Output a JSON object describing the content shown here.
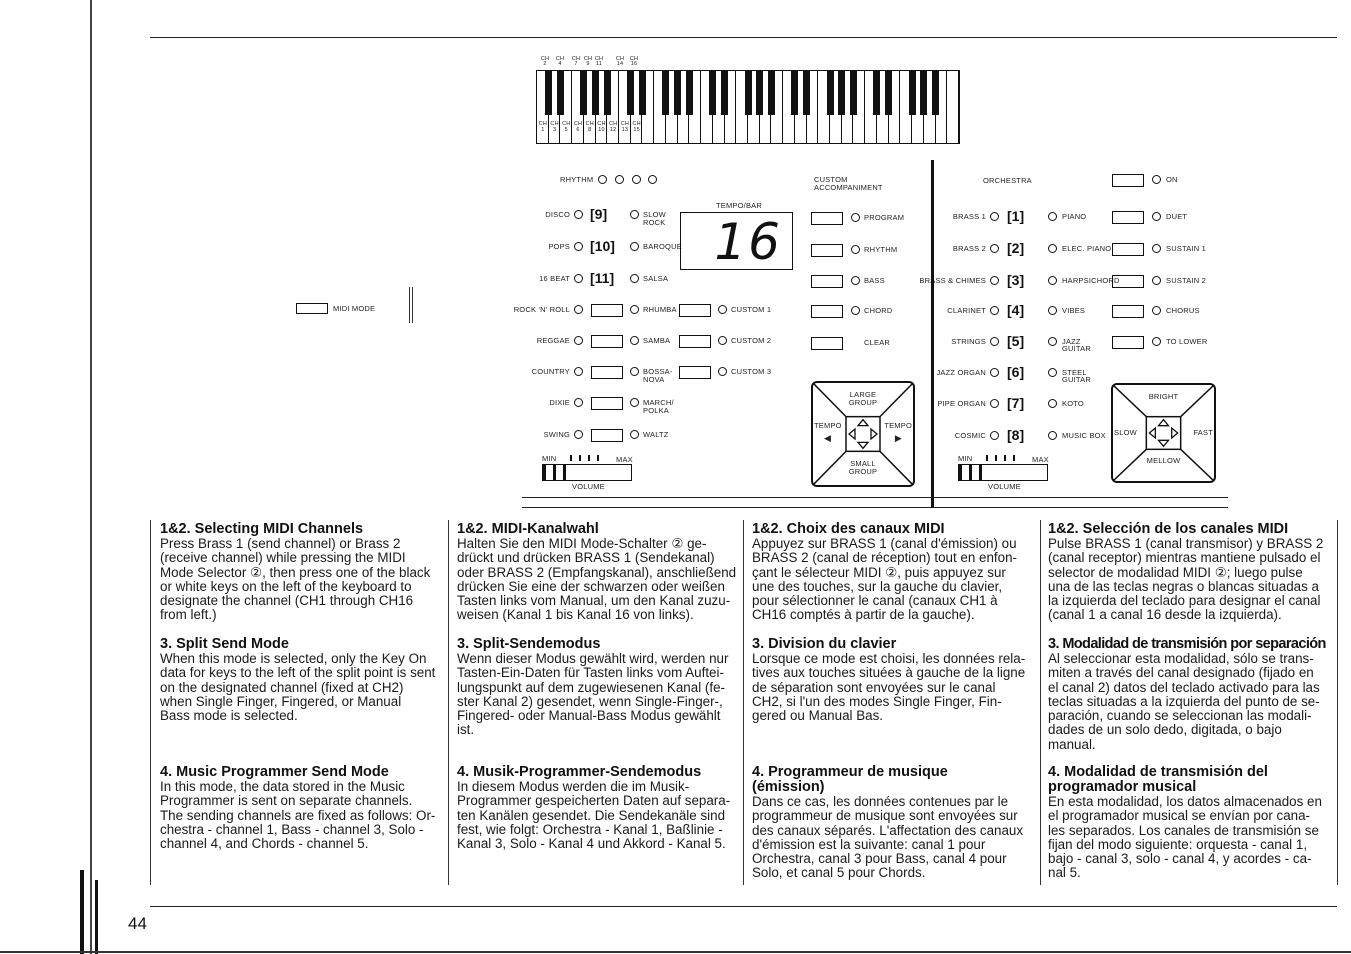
{
  "page_number": "44",
  "midi_mode_label": "MIDI MODE",
  "keyboard": {
    "black_key_channels": [
      "CH 2",
      "CH 4",
      "CH 7",
      "CH 9",
      "CH 11",
      "CH 14",
      "CH 16"
    ],
    "white_key_channels": [
      "CH 1",
      "CH 3",
      "CH 5",
      "CH 6",
      "CH 8",
      "CH 10",
      "CH 12",
      "CH 13",
      "CH 15"
    ]
  },
  "panel": {
    "rhythm_label": "RHYTHM",
    "tempo_bar_label": "TEMPO/BAR",
    "display_value": "16",
    "rhythm_rows": [
      {
        "left": "DISCO",
        "num": "[9]",
        "right": "SLOW ROCK"
      },
      {
        "left": "POPS",
        "num": "[10]",
        "right": "BAROQUE"
      },
      {
        "left": "16 BEAT",
        "num": "[11]",
        "right": "SALSA"
      },
      {
        "left": "ROCK 'N' ROLL",
        "num": "",
        "right": "RHUMBA",
        "custom": "CUSTOM 1"
      },
      {
        "left": "REGGAE",
        "num": "",
        "right": "SAMBA",
        "custom": "CUSTOM 2"
      },
      {
        "left": "COUNTRY",
        "num": "",
        "right": "BOSSA-NOVA",
        "custom": "CUSTOM 3"
      },
      {
        "left": "DIXIE",
        "num": "",
        "right": "MARCH/ POLKA"
      },
      {
        "left": "SWING",
        "num": "",
        "right": "WALTZ"
      }
    ],
    "custom_accompaniment_label": "CUSTOM ACCOMPANIMENT",
    "custom_accompaniment": [
      "PROGRAM",
      "RHYTHM",
      "BASS",
      "CHORD",
      "CLEAR"
    ],
    "left_pad": {
      "top": "LARGE GROUP",
      "bottom": "SMALL GROUP",
      "left": "TEMPO",
      "right": "TEMPO"
    },
    "volume": {
      "min": "MIN",
      "max": "MAX",
      "label": "VOLUME",
      "level_fraction": 0.25
    },
    "orchestra_label": "ORCHESTRA",
    "orchestra_rows": [
      {
        "left": "BRASS 1",
        "num": "[1]",
        "right": "PIANO"
      },
      {
        "left": "BRASS 2",
        "num": "[2]",
        "right": "ELEC. PIANO"
      },
      {
        "left": "BRASS & CHIMES",
        "num": "[3]",
        "right": "HARPSICHORD"
      },
      {
        "left": "CLARINET",
        "num": "[4]",
        "right": "VIBES"
      },
      {
        "left": "STRINGS",
        "num": "[5]",
        "right": "JAZZ GUITAR"
      },
      {
        "left": "JAZZ ORGAN",
        "num": "[6]",
        "right": "STEEL GUITAR"
      },
      {
        "left": "PIPE ORGAN",
        "num": "[7]",
        "right": "KOTO"
      },
      {
        "left": "COSMIC",
        "num": "[8]",
        "right": "MUSIC BOX"
      }
    ],
    "orchestra_buttons": [
      "ON",
      "DUET",
      "SUSTAIN 1",
      "SUSTAIN 2",
      "CHORUS",
      "TO LOWER"
    ],
    "right_pad": {
      "top": "BRIGHT",
      "bottom": "MELLOW",
      "left": "SLOW",
      "right": "FAST"
    },
    "volume2": {
      "min": "MIN",
      "max": "MAX",
      "label": "VOLUME",
      "level_fraction": 0.25
    }
  },
  "columns": [
    {
      "sections": [
        {
          "heading": "1&2. Selecting MIDI Channels",
          "body": "Press Brass 1 (send channel) or Brass 2\n(receive channel) while pressing the MIDI\nMode Selector ②, then press one of the black\nor white keys on the left of the keyboard to\ndesignate the channel (CH1 through CH16\nfrom left.)"
        },
        {
          "heading": "3. Split Send Mode",
          "body": "When this mode is selected, only the Key On\ndata for keys to the left of the split point is sent\non the designated channel (fixed at CH2)\nwhen Single Finger, Fingered, or Manual\nBass mode is selected."
        },
        {
          "heading": "4. Music Programmer Send Mode",
          "body": "In this mode, the data stored in the Music\nProgrammer is sent on separate channels.\nThe sending channels are fixed as follows: Or-\nchestra - channel 1, Bass - channel 3, Solo -\nchannel 4, and Chords - channel 5."
        }
      ]
    },
    {
      "sections": [
        {
          "heading": "1&2. MIDI-Kanalwahl",
          "body": "Halten Sie den MIDI Mode-Schalter ② ge-\ndrückt und drücken BRASS 1 (Sendekanal)\noder BRASS 2 (Empfangskanal), anschließend\ndrücken Sie eine der schwarzen oder weißen\nTasten links vom Manual, um den Kanal zuzu-\nweisen (Kanal 1 bis Kanal 16 von links)."
        },
        {
          "heading": "3. Split-Sendemodus",
          "body": "Wenn dieser Modus gewählt wird, werden nur\nTasten-Ein-Daten für Tasten links vom Auftei-\nlungspunkt auf dem zugewiesenen Kanal (fe-\nster Kanal 2) gesendet, wenn Single-Finger-,\nFingered- oder Manual-Bass Modus gewählt\nist."
        },
        {
          "heading": "4. Musik-Programmer-Sendemodus",
          "body": "In diesem Modus werden die im Musik-\nProgrammer gespeicherten Daten auf separa-\nten Kanälen gesendet. Die Sendekanäle sind\nfest, wie folgt: Orchestra - Kanal 1, Baßlinie -\nKanal 3, Solo - Kanal 4 und Akkord - Kanal 5."
        }
      ]
    },
    {
      "sections": [
        {
          "heading": "1&2. Choix des canaux MIDI",
          "body": "Appuyez sur BRASS 1 (canal d'émission) ou\nBRASS 2 (canal de réception) tout en enfon-\nçant le sélecteur MIDI ②, puis appuyez sur\nune des touches, sur la gauche du clavier,\npour sélectionner le canal (canaux CH1 à\nCH16 comptés à partir de la gauche)."
        },
        {
          "heading": "3. Division du clavier",
          "body": "Lorsque ce mode est choisi, les données rela-\ntives aux touches situées à gauche de la ligne\nde séparation sont envoyées sur le canal\nCH2, si l'un des modes Single Finger, Fin-\ngered ou Manual Bas."
        },
        {
          "heading": "4. Programmeur de musique\n    (émission)",
          "body": "Dans ce cas, les données contenues par le\nprogrammeur de musique sont envoyées sur\ndes canaux séparés. L'affectation des canaux\nd'émission est la suivante: canal 1 pour\nOrchestra, canal 3 pour Bass, canal 4 pour\nSolo, et canal 5 pour Chords."
        }
      ]
    },
    {
      "sections": [
        {
          "heading": "1&2. Selección de los canales MIDI",
          "body": "Pulse BRASS 1 (canal transmisor) y BRASS 2\n(canal receptor) mientras mantiene pulsado el\nselector de modalidad MIDI ②; luego pulse\nuna de las teclas negras o blancas situadas a\nla izquierda del teclado para designar el canal\n(canal 1 a canal 16 desde la izquierda)."
        },
        {
          "heading": "3. Modalidad de transmisión por separación",
          "body": "Al seleccionar esta modalidad, sólo se trans-\nmiten a través del canal designado (fijado en\nel canal 2) datos del teclado activado para las\nteclas situadas a la izquierda del punto de se-\nparación, cuando se seleccionan las modali-\ndades de un solo dedo, digitada, o bajo\nmanual."
        },
        {
          "heading": "4. Modalidad de transmisión del\n    programador musical",
          "body": "En esta modalidad, los datos almacenados en\nel programador musical se envían por cana-\nles separados. Los canales de transmisión se\nfijan del modo siguiente: orquesta - canal 1,\nbajo - canal 3, solo - canal 4, y acordes - ca-\nnal 5."
        }
      ]
    }
  ]
}
